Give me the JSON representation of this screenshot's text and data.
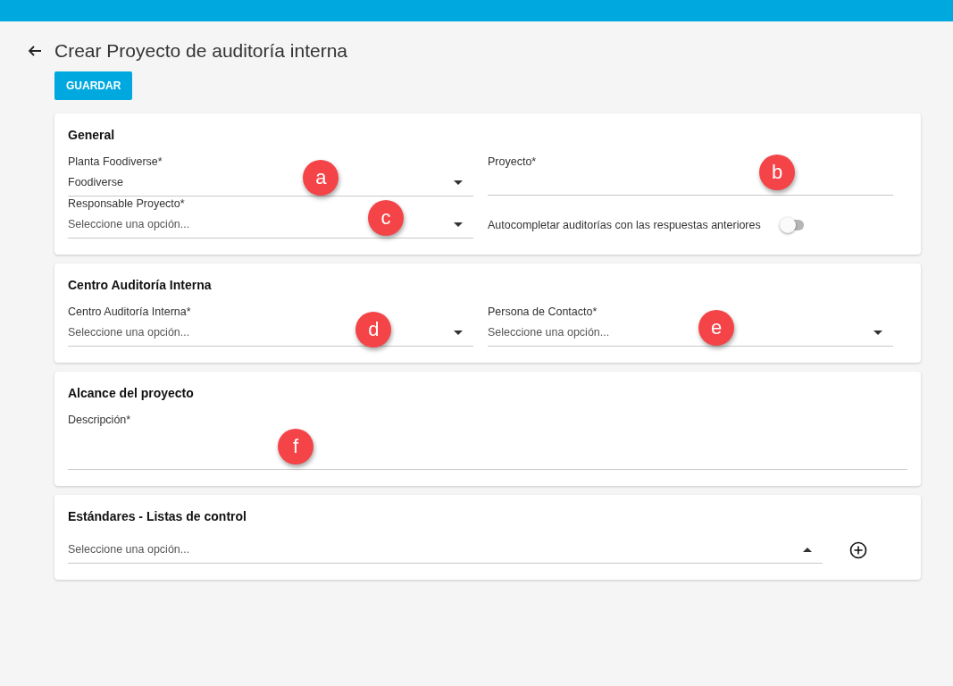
{
  "header": {
    "title": "Crear Proyecto de auditoría interna",
    "save_button": "GUARDAR"
  },
  "sections": [
    {
      "title": "General",
      "fields": [
        {
          "kind": "select",
          "label": "Planta Foodiverse*",
          "value": "Foodiverse",
          "expanded": false,
          "marker": "a"
        },
        {
          "kind": "text",
          "label": "Proyecto*",
          "marker": "b"
        },
        {
          "kind": "select",
          "label": "Responsable Proyecto*",
          "placeholder": "Seleccione una opción...",
          "expanded": false,
          "marker": "c"
        },
        {
          "kind": "toggle",
          "label": "Autocompletar auditorías con las respuestas anteriores",
          "on": false
        }
      ]
    },
    {
      "title": "Centro Auditoría Interna",
      "fields": [
        {
          "kind": "select",
          "label": "Centro Auditoría Interna*",
          "placeholder": "Seleccione una opción...",
          "expanded": false,
          "marker": "d"
        },
        {
          "kind": "select",
          "label": "Persona de Contacto*",
          "placeholder": "Seleccione una opción...",
          "expanded": false,
          "marker": "e"
        }
      ]
    },
    {
      "title": "Alcance del proyecto",
      "fields": [
        {
          "kind": "textarea",
          "label": "Descripción*",
          "marker": "f"
        }
      ]
    },
    {
      "title": "Estándares - Listas de control",
      "fields": [
        {
          "kind": "select_add",
          "placeholder": "Seleccione una opción...",
          "expanded": true
        }
      ]
    }
  ]
}
